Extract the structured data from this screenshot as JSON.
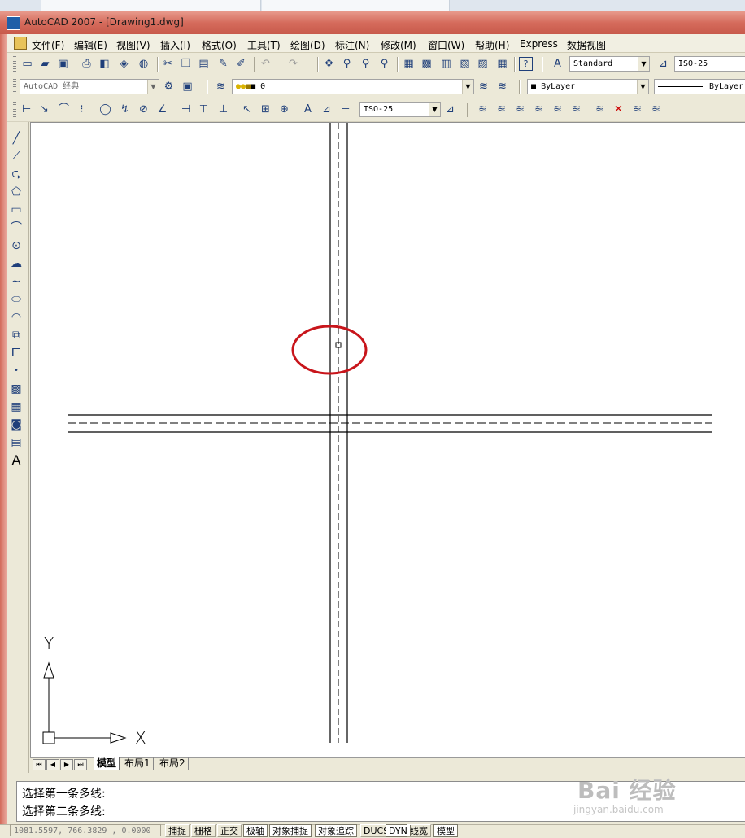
{
  "window": {
    "title": "AutoCAD 2007 - [Drawing1.dwg]"
  },
  "menu": {
    "items": [
      "文件(F)",
      "编辑(E)",
      "视图(V)",
      "插入(I)",
      "格式(O)",
      "工具(T)",
      "绘图(D)",
      "标注(N)",
      "修改(M)",
      "窗口(W)",
      "帮助(H)",
      "Express",
      "数据视图"
    ]
  },
  "toolbars": {
    "text_style": "Standard",
    "dim_style_top": "ISO-25",
    "workspace": "AutoCAD 经典",
    "layer_name": "0",
    "color": "ByLayer",
    "linetype": "ByLayer",
    "dim_style_dimension": "ISO-25"
  },
  "icons": {
    "standard": [
      "new-icon",
      "open-icon",
      "save-icon",
      "plot-icon",
      "plot-preview-icon",
      "publish-icon",
      "3d-dwf-icon",
      "cut-icon",
      "copy-icon",
      "paste-icon",
      "match-properties-icon",
      "block-editor-icon",
      "undo-icon",
      "redo-icon",
      "pan-icon",
      "zoom-realtime-icon",
      "zoom-window-icon",
      "zoom-previous-icon",
      "properties-icon",
      "design-center-icon",
      "tool-palettes-icon",
      "sheet-set-icon",
      "markup-icon",
      "calculator-icon",
      "help-icon"
    ],
    "draw": [
      "line-icon",
      "construction-line-icon",
      "polyline-icon",
      "polygon-icon",
      "rectangle-icon",
      "arc-icon",
      "circle-icon",
      "revision-cloud-icon",
      "spline-icon",
      "ellipse-icon",
      "ellipse-arc-icon",
      "insert-block-icon",
      "make-block-icon",
      "point-icon",
      "hatch-icon",
      "gradient-icon",
      "region-icon",
      "table-icon",
      "multiline-text-icon"
    ]
  },
  "drawing": {
    "ucs_x_label": "X",
    "ucs_y_label": "Y"
  },
  "layout_tabs": [
    "模型",
    "布局1",
    "布局2"
  ],
  "command": {
    "lines": [
      "选择第一条多线:",
      "选择第二条多线:"
    ]
  },
  "status": {
    "coordinates": "1081.5597, 766.3829 , 0.0000",
    "buttons": [
      "捕捉",
      "栅格",
      "正交",
      "极轴",
      "对象捕捉",
      "对象追踪",
      "DUCS",
      "DYN",
      "线宽",
      "模型"
    ]
  },
  "watermark": {
    "brand": "Bai 经验",
    "url": "jingyan.baidu.com"
  },
  "colors": {
    "titlebar": "#d56b5c",
    "highlight_circle": "#c8151b",
    "canvas": "#ffffff"
  }
}
